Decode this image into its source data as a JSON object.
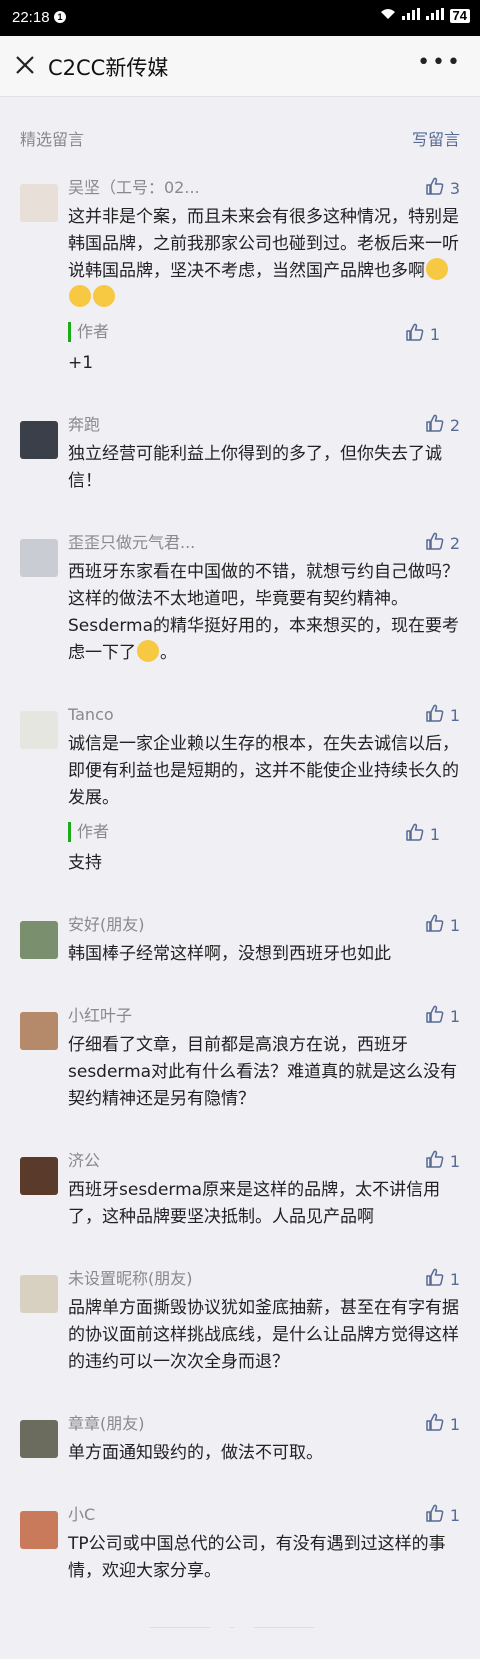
{
  "status_bar": {
    "time": "22:18",
    "notification_count": "1",
    "battery": "74"
  },
  "navbar": {
    "title": "C2CC新传媒"
  },
  "section": {
    "left_label": "精选留言",
    "right_label": "写留言"
  },
  "comments": [
    {
      "nick": "吴坚（工号：02...",
      "likes": "3",
      "text": "这并非是个案，而且未来会有很多这种情况，特别是韩国品牌，之前我那家公司也碰到过。老板后来一听说韩国品牌，坚决不考虑，当然国产品牌也多啊",
      "emoji_count": 3,
      "reply": {
        "author": "作者",
        "likes": "1",
        "text": "+1"
      }
    },
    {
      "nick": "奔跑",
      "likes": "2",
      "text": "独立经营可能利益上你得到的多了，但你失去了诚信！"
    },
    {
      "nick": "歪歪只做元气君...",
      "likes": "2",
      "text": "西班牙东家看在中国做的不错，就想亏约自己做吗？这样的做法不太地道吧，毕竟要有契约精神。Sesderma的精华挺好用的，本来想买的，现在要考虑一下了",
      "text_after_emoji": "。",
      "emoji_count": 1
    },
    {
      "nick": "Tanco",
      "likes": "1",
      "text": "诚信是一家企业赖以生存的根本，在失去诚信以后，即便有利益也是短期的，这并不能使企业持续长久的发展。",
      "reply": {
        "author": "作者",
        "likes": "1",
        "text": "支持"
      }
    },
    {
      "nick": "安好(朋友)",
      "likes": "1",
      "text": "韩国棒子经常这样啊，没想到西班牙也如此"
    },
    {
      "nick": "小红叶子",
      "likes": "1",
      "text": "仔细看了文章，目前都是高浪方在说，西班牙sesderma对此有什么看法？难道真的就是这么没有契约精神还是另有隐情？"
    },
    {
      "nick": "济公",
      "likes": "1",
      "text": "西班牙sesderma原来是这样的品牌，太不讲信用了，这种品牌要坚决抵制。人品见产品啊"
    },
    {
      "nick": "未设置昵称(朋友)",
      "likes": "1",
      "text": "品牌单方面撕毁协议犹如釜底抽薪，甚至在有字有据的协议面前这样挑战底线，是什么让品牌方觉得这样的违约可以一次次全身而退？"
    },
    {
      "nick": "章章(朋友)",
      "likes": "1",
      "text": "单方面通知毁约的，做法不可取。"
    },
    {
      "nick": "小C",
      "likes": "1",
      "text": "TP公司或中国总代的公司，有没有遇到过这样的事情，欢迎大家分享。"
    }
  ],
  "colors": {
    "link": "#576b95",
    "author_bar": "#1aad19",
    "background": "#efeff4"
  }
}
